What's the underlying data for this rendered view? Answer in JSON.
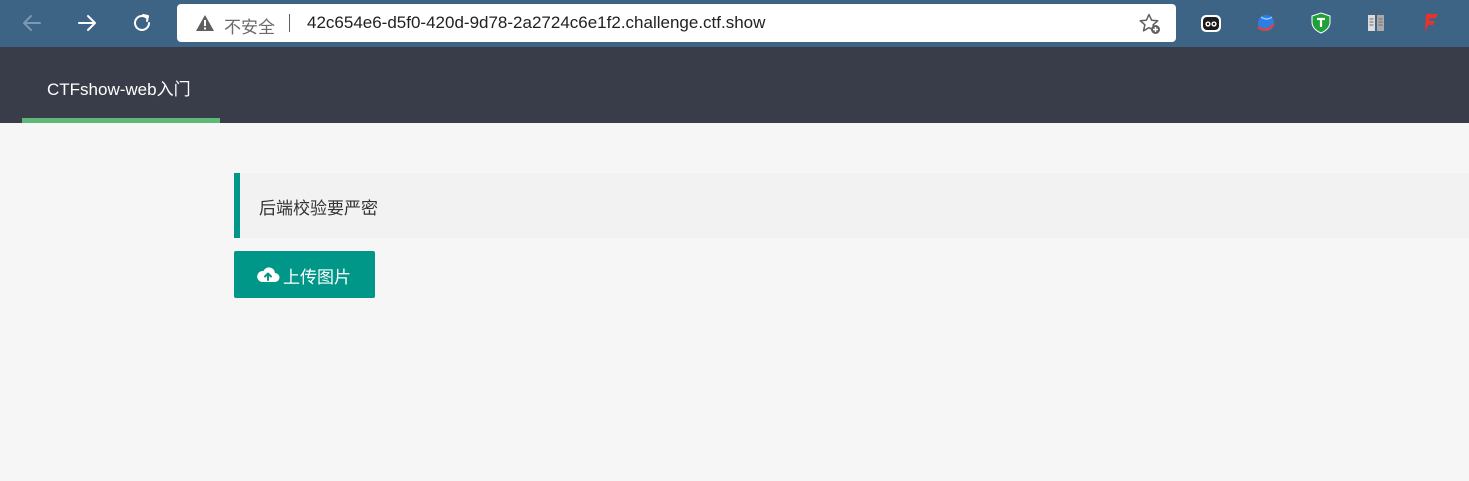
{
  "browser": {
    "address_bar": {
      "security_label": "不安全",
      "url": "42c654e6-d5f0-420d-9d78-2a2724c6e1f2.challenge.ctf.show"
    },
    "icons": {
      "back": "arrow-left-icon",
      "forward": "arrow-right-icon",
      "reload": "reload-icon",
      "warning": "warning-triangle-icon",
      "favorite": "star-add-icon"
    },
    "extensions": [
      "ghost-extension-icon",
      "globe-extension-icon",
      "shield-extension-icon",
      "reader-extension-icon",
      "flash-extension-icon"
    ],
    "colors": {
      "toolbar": "#3e6485",
      "address_bg": "#ffffff"
    }
  },
  "site_nav": {
    "items": [
      {
        "label": "CTFshow-web入门",
        "active": true
      }
    ],
    "colors": {
      "background": "#393d49",
      "active_bar": "#5fb878"
    }
  },
  "content": {
    "quote": "后端校验要严密",
    "upload_button": {
      "label": "上传图片",
      "icon": "cloud-upload-icon"
    },
    "colors": {
      "accent": "#009688",
      "quote_bg": "#f2f2f2",
      "page_bg": "#f6f6f6"
    }
  }
}
